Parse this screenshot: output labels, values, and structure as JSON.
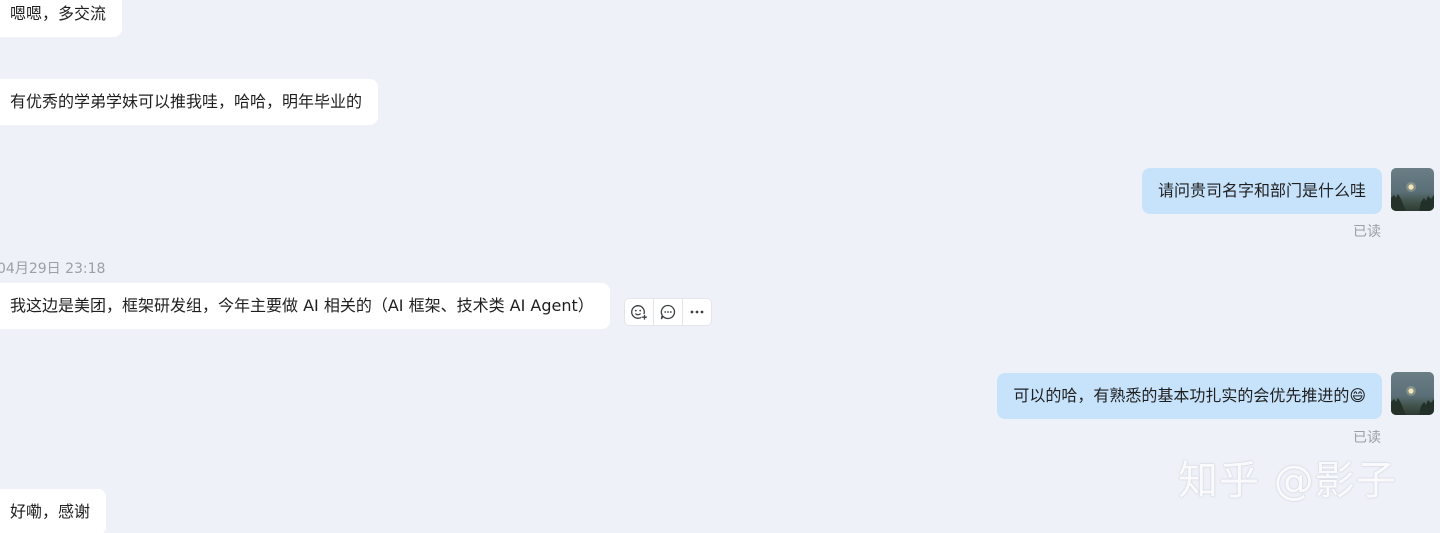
{
  "messages": {
    "m1": "嗯嗯，多交流",
    "m2": "有优秀的学弟学妹可以推我哇，哈哈，明年毕业的",
    "m3": "请问贵司名字和部门是什么哇",
    "timestamp": "04月29日 23:18",
    "m4": "我这边是美团，框架研发组，今年主要做 AI 相关的（AI 框架、技术类 AI Agent）",
    "m5": "可以的哈，有熟悉的基本功扎实的会优先推进的😄",
    "m6": "好嘞，感谢"
  },
  "read_status": "已读",
  "watermark": "知乎 @影子",
  "icons": {
    "add_reaction": "add-emoji-icon",
    "reply": "comment-bubble-icon",
    "more": "more-dots-icon"
  },
  "colors": {
    "background": "#eef1f7",
    "incoming_bubble": "#ffffff",
    "outgoing_bubble": "#c7e3fc",
    "muted_text": "#9aa0a6"
  }
}
